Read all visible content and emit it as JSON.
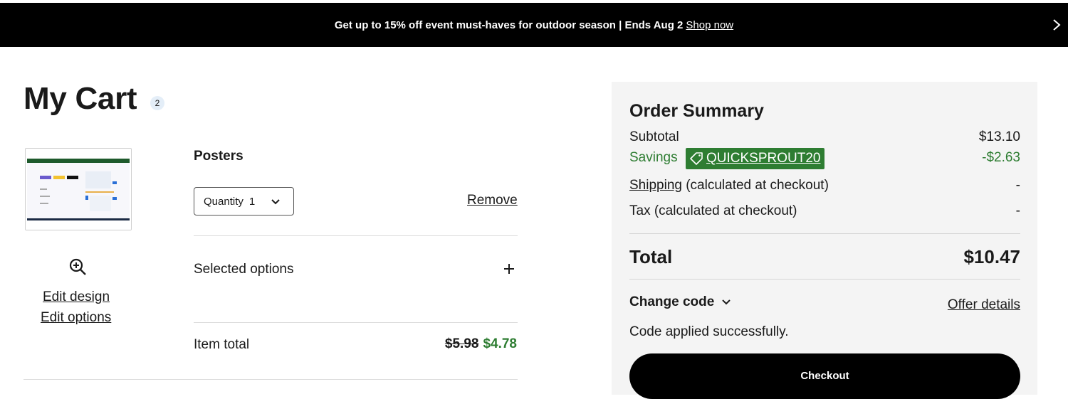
{
  "banner": {
    "message": "Get up to 15% off event must-haves for outdoor season | Ends Aug 2",
    "link": "Shop now",
    "next_icon": "chevron-right-icon"
  },
  "cart": {
    "title": "My Cart",
    "count": "2"
  },
  "item": {
    "name": "Posters",
    "quantity_label": "Quantity",
    "quantity_value": "1",
    "remove": "Remove",
    "edit_design": "Edit design",
    "edit_options": "Edit options",
    "selected_options": "Selected options",
    "item_total_label": "Item total",
    "original_price": "$5.98",
    "sale_price": "$4.78"
  },
  "summary": {
    "title": "Order Summary",
    "subtotal_label": "Subtotal",
    "subtotal_value": "$13.10",
    "savings_label": "Savings",
    "promo_code": "QUICKSPROUT20",
    "savings_value": "-$2.63",
    "shipping_link": "Shipping",
    "shipping_suffix": "(calculated at checkout)",
    "shipping_value": "-",
    "tax_label": "Tax (calculated at checkout)",
    "tax_value": "-",
    "total_label": "Total",
    "total_value": "$10.47",
    "change_code": "Change code",
    "offer_details": "Offer details",
    "applied_message": "Code applied successfully.",
    "checkout": "Checkout"
  },
  "colors": {
    "savings_green": "#2e7d32",
    "summary_bg": "#f4f4f4",
    "banner_bg": "#000000"
  }
}
